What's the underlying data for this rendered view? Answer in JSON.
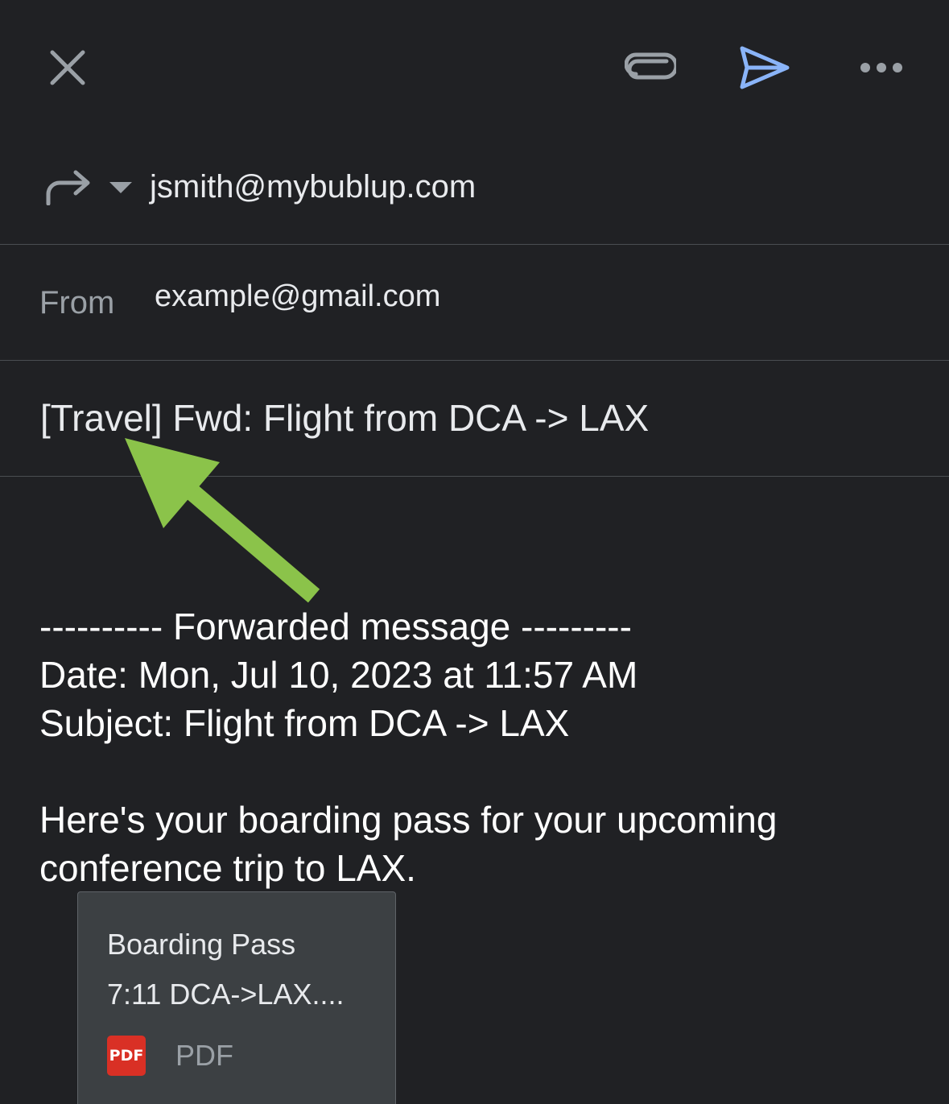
{
  "toolbar": {
    "close_icon": "close-icon",
    "attach_icon": "paperclip-icon",
    "send_icon": "send-icon",
    "more_icon": "more-horizontal-icon",
    "send_color": "#8ab4f8"
  },
  "compose": {
    "reply_icon": "forward-arrow-icon",
    "dropdown_icon": "caret-down-icon",
    "to": "jsmith@mybublup.com",
    "from_label": "From",
    "from_value": "example@gmail.com",
    "subject": "[Travel] Fwd: Flight from DCA -> LAX"
  },
  "body": {
    "forward_header": "---------- Forwarded message ---------",
    "date_line": "Date: Mon, Jul 10, 2023 at 11:57 AM",
    "subject_line": "Subject: Flight from DCA -> LAX",
    "message_line1": "Here's your boarding pass for your upcoming",
    "message_line2": "conference trip to LAX."
  },
  "attachment": {
    "title": "Boarding Pass",
    "subtitle": "7:11 DCA->LAX....",
    "badge": "PDF",
    "type": "PDF",
    "badge_color": "#d93025"
  },
  "annotation": {
    "arrow_color": "#8bc34a"
  }
}
